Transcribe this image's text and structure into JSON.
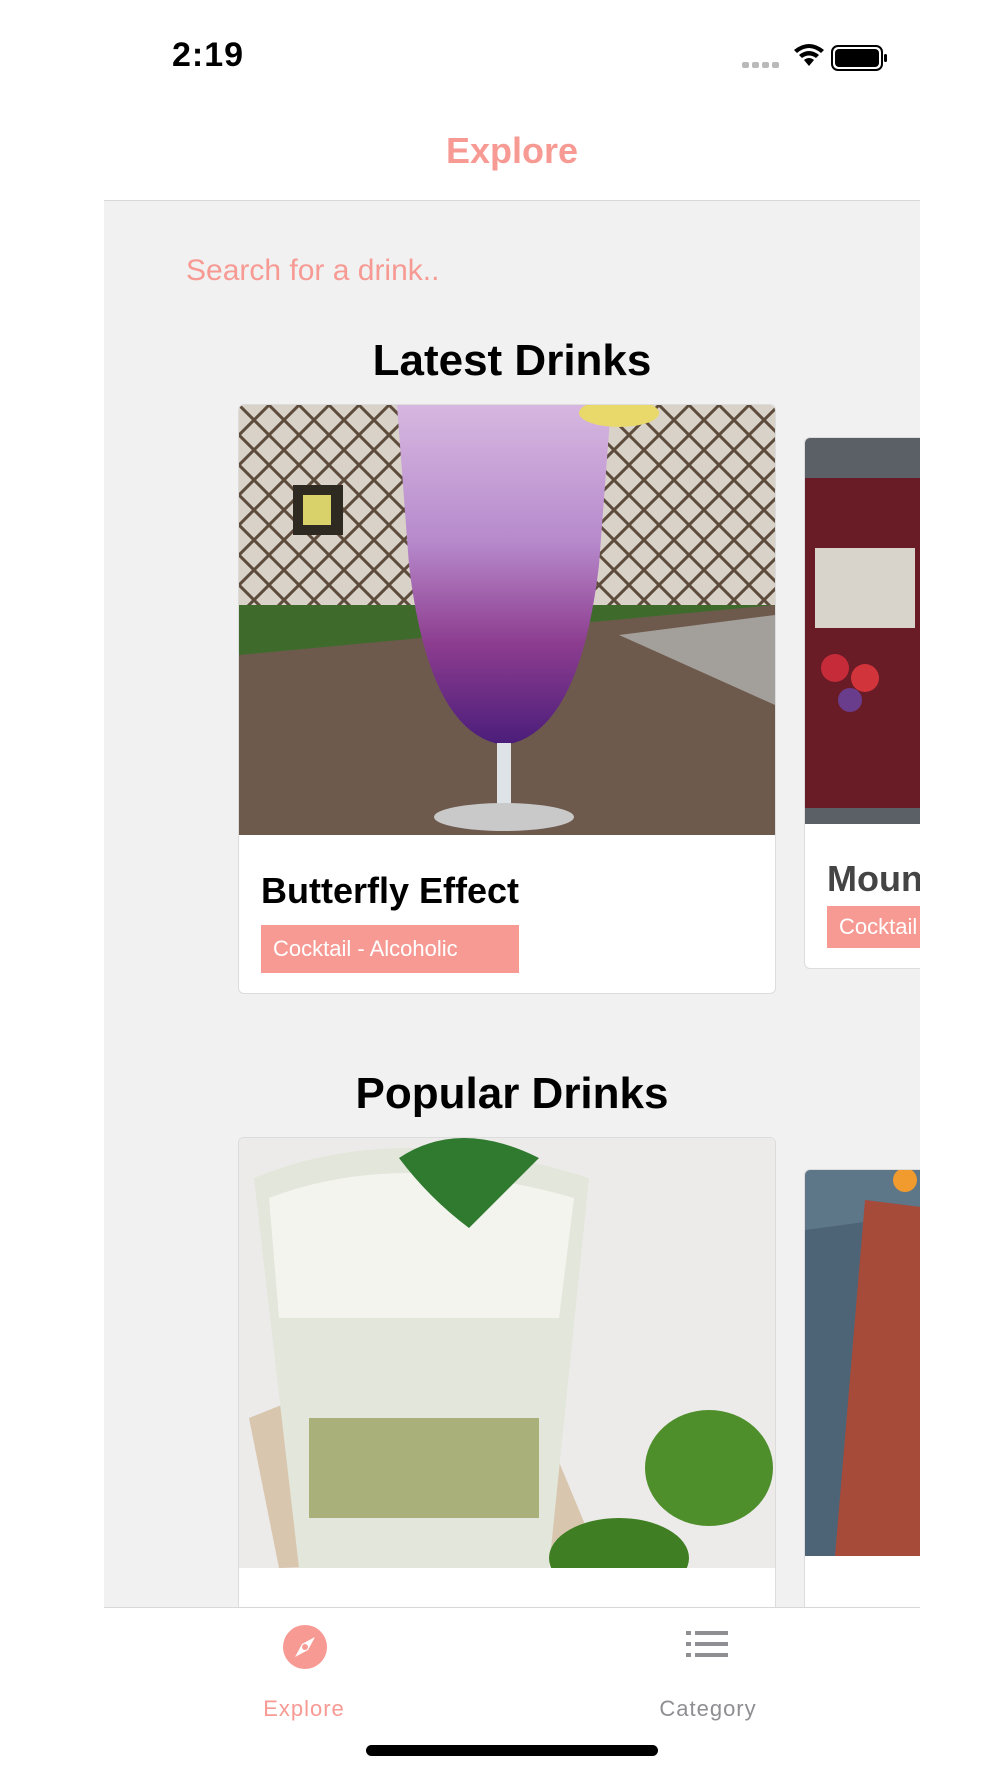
{
  "status": {
    "time": "2:19"
  },
  "header": {
    "title": "Explore"
  },
  "search": {
    "placeholder": "Search for a drink.."
  },
  "sections": {
    "latest": {
      "title": "Latest Drinks",
      "cards": [
        {
          "name": "Butterfly Effect",
          "category": "Cocktail - Alcoholic"
        },
        {
          "name": "Moun",
          "category": "Cocktail"
        }
      ]
    },
    "popular": {
      "title": "Popular Drinks",
      "cards": [
        {
          "name": "",
          "category": ""
        },
        {
          "name": "",
          "category": ""
        }
      ]
    }
  },
  "tabs": [
    {
      "label": "Explore",
      "icon": "compass-icon",
      "active": true
    },
    {
      "label": "Category",
      "icon": "list-icon",
      "active": false
    }
  ],
  "colors": {
    "accent": "#f79a94",
    "inactive": "#8e8e93",
    "background": "#f1f1f1"
  }
}
